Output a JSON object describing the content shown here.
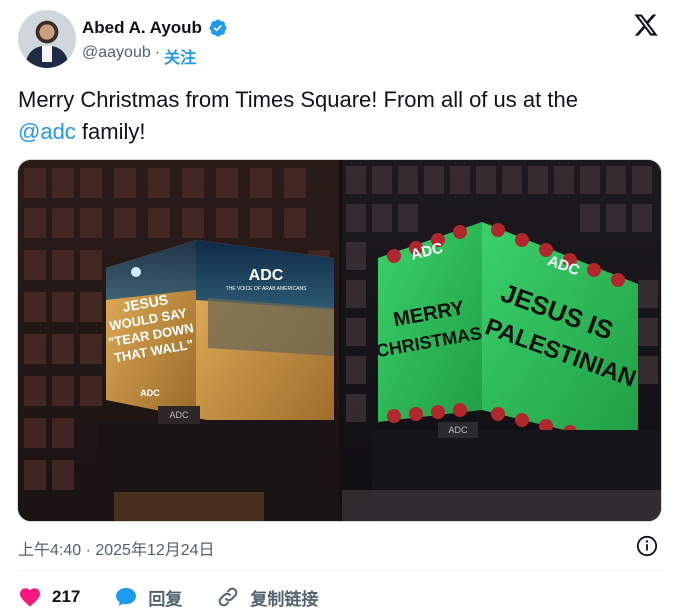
{
  "author": {
    "name": "Abed A. Ayoub",
    "handle": "@aayoub",
    "separator": "·",
    "follow_label": "关注"
  },
  "tweet": {
    "text_before": "Merry Christmas from Times Square! From all of us at the",
    "mention": "@adc",
    "text_after": " family!"
  },
  "media": {
    "left": {
      "brand": "ADC",
      "tagline": "THE VOICE OF ARAB AMERICANS",
      "billboard_lines": [
        "JESUS",
        "WOULD SAY",
        "\"TEAR DOWN",
        "THAT WALL\""
      ],
      "bottom_brand": "ADC",
      "building_sign": "ADC"
    },
    "right": {
      "brand": "ADC",
      "brand_right": "ADC",
      "left_face_lines": [
        "MERRY",
        "CHRISTMAS"
      ],
      "right_face_lines": [
        "JESUS IS",
        "PALESTINIAN"
      ],
      "building_sign": "ADC"
    }
  },
  "meta": {
    "timestamp": "上午4:40 · 2025年12月24日"
  },
  "actions": {
    "like_count": "217",
    "reply_label": "回复",
    "copy_link_label": "复制链接"
  },
  "colors": {
    "accent": "#1d9bf0",
    "like": "#f91880",
    "text": "#0f1419",
    "muted": "#536471"
  }
}
